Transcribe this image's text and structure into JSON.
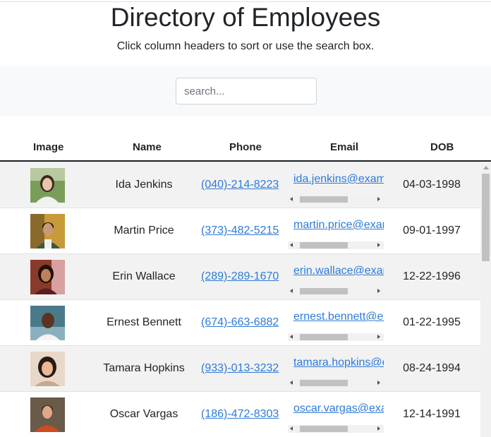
{
  "header": {
    "title": "Directory of Employees",
    "subtitle": "Click column headers to sort or use the search box."
  },
  "search": {
    "placeholder": "search...",
    "value": ""
  },
  "table": {
    "columns": [
      "Image",
      "Name",
      "Phone",
      "Email",
      "DOB"
    ],
    "rows": [
      {
        "name": "Ida Jenkins",
        "phone": "(040)-214-8223",
        "email": "ida.jenkins@example.com",
        "dob": "04-03-1998",
        "avatar_color": "#7a9e5a"
      },
      {
        "name": "Martin Price",
        "phone": "(373)-482-5215",
        "email": "martin.price@example.com",
        "dob": "09-01-1997",
        "avatar_color": "#8a6a2a"
      },
      {
        "name": "Erin Wallace",
        "phone": "(289)-289-1670",
        "email": "erin.wallace@example.com",
        "dob": "12-22-1996",
        "avatar_color": "#8a3a2a"
      },
      {
        "name": "Ernest Bennett",
        "phone": "(674)-663-6882",
        "email": "ernest.bennett@example.com",
        "dob": "01-22-1995",
        "avatar_color": "#4a7a8a"
      },
      {
        "name": "Tamara Hopkins",
        "phone": "(933)-013-3232",
        "email": "tamara.hopkins@example.com",
        "dob": "08-24-1994",
        "avatar_color": "#c8a890"
      },
      {
        "name": "Oscar Vargas",
        "phone": "(186)-472-8303",
        "email": "oscar.vargas@example.com",
        "dob": "12-14-1991",
        "avatar_color": "#c04a2a"
      }
    ]
  },
  "colors": {
    "link": "#2f7ad8",
    "stripe": "#f2f2f2",
    "search_band": "#f8f9fa",
    "header_rule": "#212529"
  }
}
